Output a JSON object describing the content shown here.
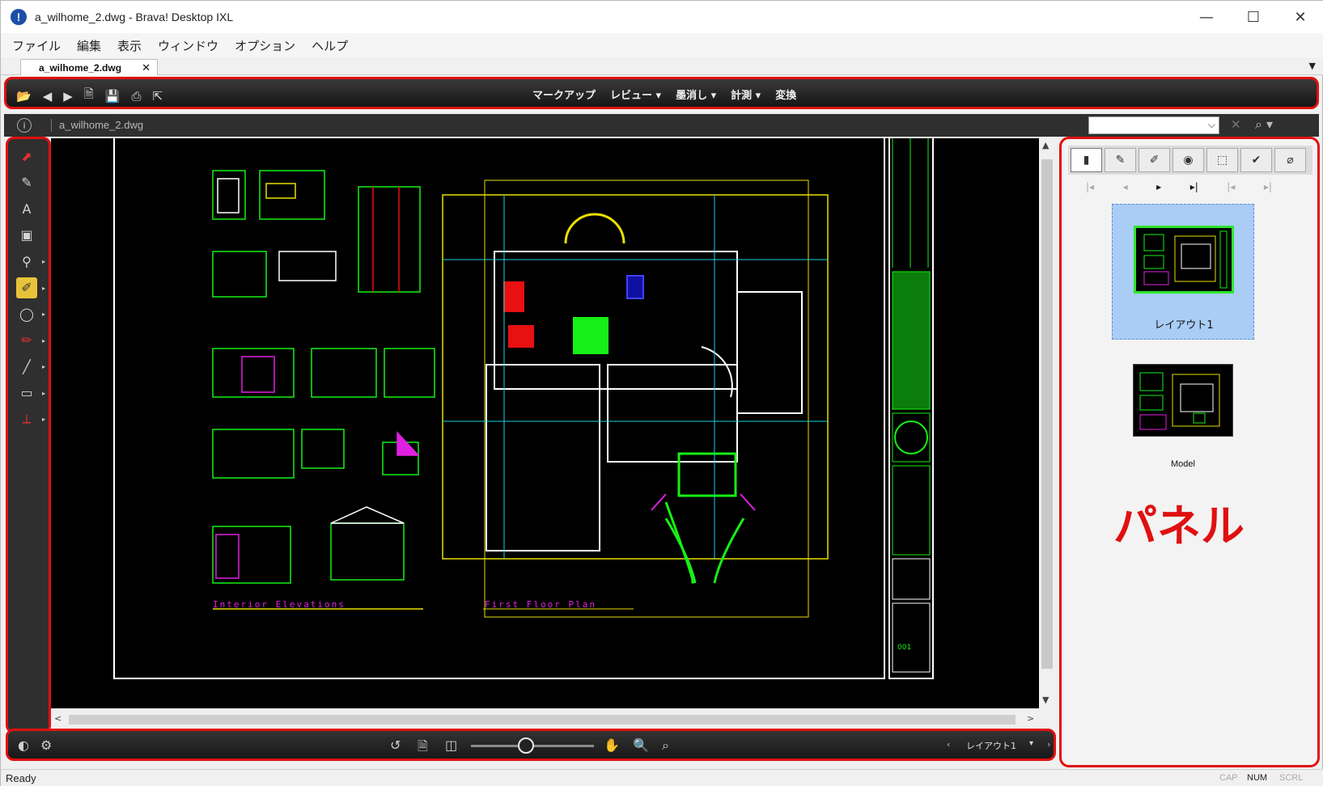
{
  "window": {
    "title": "a_wilhome_2.dwg - Brava! Desktop IXL",
    "app_icon_glyph": "!",
    "minimize": "—",
    "maximize": "☐",
    "close": "✕"
  },
  "menu": {
    "items": [
      "ファイル",
      "編集",
      "表示",
      "ウィンドウ",
      "オプション",
      "ヘルプ"
    ]
  },
  "document_tab": {
    "label": "a_wilhome_2.dwg",
    "close": "✕",
    "overflow": "▼"
  },
  "toolbar": {
    "icons": [
      "folder-open-icon",
      "back-icon",
      "forward-icon",
      "new-document-icon",
      "save-icon",
      "print-icon",
      "select-cursor-icon"
    ],
    "center_menu": [
      "マークアップ",
      "レビュー ▾",
      "墨消し ▾",
      "計測 ▾",
      "変換"
    ]
  },
  "address": {
    "path": "a_wilhome_2.dwg",
    "info_glyph": "i",
    "search_value": "",
    "search_dropdown": "⌵",
    "clear_glyph": "✕",
    "find_glyph": "⌕ ▾"
  },
  "left_tools": [
    {
      "name": "markup-pointer-icon",
      "glyph": "⬈",
      "style": "red",
      "more": false
    },
    {
      "name": "pen-icon",
      "glyph": "✎",
      "style": "",
      "more": false
    },
    {
      "name": "text-icon",
      "glyph": "A",
      "style": "",
      "more": false
    },
    {
      "name": "image-stamp-icon",
      "glyph": "▣",
      "style": "",
      "more": false
    },
    {
      "name": "pushpin-icon",
      "glyph": "⚲",
      "style": "",
      "more": true
    },
    {
      "name": "highlighter-icon",
      "glyph": "✐",
      "style": "yellow",
      "more": true
    },
    {
      "name": "ellipse-icon",
      "glyph": "◯",
      "style": "",
      "more": true
    },
    {
      "name": "freehand-icon",
      "glyph": "✏",
      "style": "red",
      "more": true
    },
    {
      "name": "line-icon",
      "glyph": "╱",
      "style": "",
      "more": true
    },
    {
      "name": "rectangle-icon",
      "glyph": "▭",
      "style": "",
      "more": true
    },
    {
      "name": "dimension-icon",
      "glyph": "⟂",
      "style": "red",
      "more": true
    }
  ],
  "more_glyph": "▸",
  "drawing": {
    "label_interior": "Interior Elevations",
    "label_floor": "First Floor Plan",
    "colors": {
      "yellow": "#e8e000",
      "green": "#16f016",
      "cyan": "#19d5e0",
      "magenta": "#e020e0",
      "red": "#e81010",
      "white": "#ffffff"
    }
  },
  "scroll": {
    "up": "▲",
    "down": "▼",
    "left": "<",
    "right": ">"
  },
  "navbar": {
    "left_icons": [
      "brightness-icon",
      "settings-icon"
    ],
    "center_icons": [
      "rotate-icon",
      "fit-page-icon",
      "fit-width-icon",
      "pan-hand-icon",
      "zoom-window-icon",
      "zoom-icon"
    ],
    "zoom_level_fraction": 0.45,
    "layout_value": "レイアウト1",
    "dropdown": "▾",
    "prev": "‹",
    "next": "›"
  },
  "panel": {
    "tabs": [
      "▮",
      "✎",
      "✐",
      "◉",
      "⬚",
      "✔",
      "⌀"
    ],
    "pagenav": [
      "|◂",
      "◂",
      "▸",
      "▸|",
      "|◂",
      "▸|"
    ],
    "thumbnails": [
      {
        "label": "レイアウト1",
        "selected": true
      },
      {
        "label": "Model",
        "selected": false
      }
    ],
    "annotation": "パネル"
  },
  "status": {
    "text": "Ready",
    "indicators": [
      {
        "label": "CAP",
        "on": false
      },
      {
        "label": "NUM",
        "on": true
      },
      {
        "label": "SCRL",
        "on": false
      }
    ]
  }
}
